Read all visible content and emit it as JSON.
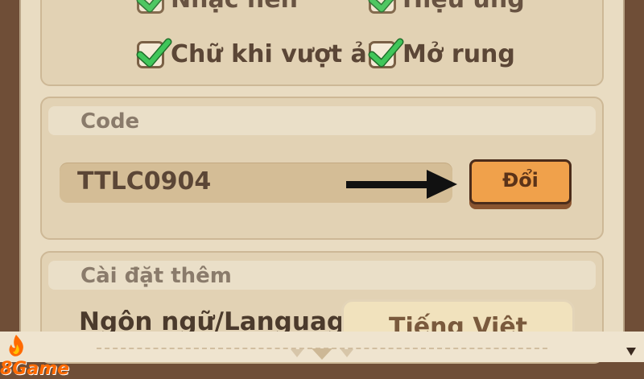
{
  "colors": {
    "background": "#6f4e37",
    "panel": "#e9dcc2",
    "check_green": "#33b44a",
    "button_orange": "#f0a14b"
  },
  "audio": {
    "checkboxes": [
      {
        "label": "Nhạc nền",
        "checked": true
      },
      {
        "label": "Hiệu ứng",
        "checked": true
      },
      {
        "label": "Chữ khi vượt ải",
        "checked": true
      },
      {
        "label": "Mở rung",
        "checked": true
      }
    ]
  },
  "code": {
    "title": "Code",
    "value": "TTLC0904",
    "button_label": "Đổi"
  },
  "extra": {
    "title": "Cài đặt thêm",
    "language_label": "Ngôn ngữ/Language",
    "language_value": "Tiếng Việt"
  },
  "watermark": {
    "text": "8Game"
  },
  "icons": {
    "check": "check-icon",
    "arrow": "arrow-right-icon",
    "page_indicator": "triangle-down-icon"
  }
}
